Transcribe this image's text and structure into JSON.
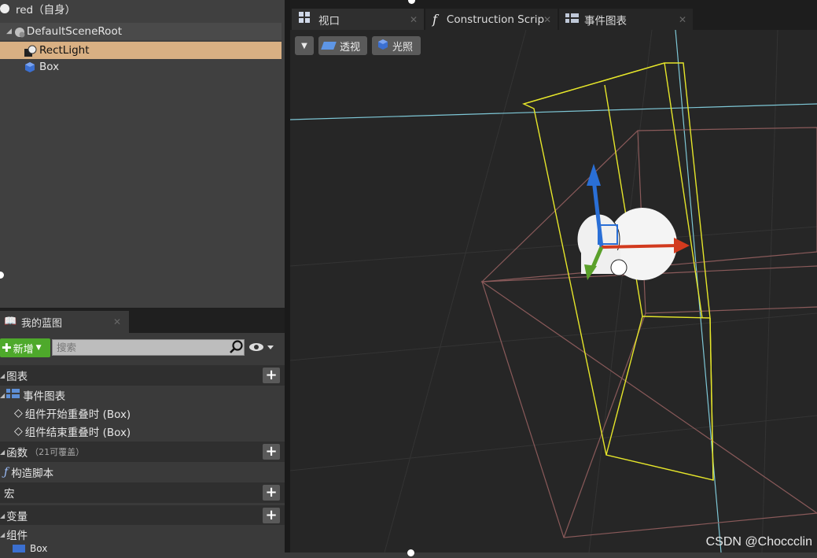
{
  "components": {
    "self": "red（自身）",
    "root": "DefaultSceneRoot",
    "items": [
      "RectLight",
      "Box"
    ]
  },
  "blueprint": {
    "tab_title": "我的蓝图",
    "add_label": "新增",
    "search_placeholder": "搜索",
    "sections": {
      "graphs": "图表",
      "event_graph": "事件图表",
      "events": [
        "组件开始重叠时 (Box)",
        "组件结束重叠时 (Box)"
      ],
      "functions": "函数",
      "functions_sub": "（21可覆盖）",
      "construction": "构造脚本",
      "macros": "宏",
      "variables": "变量",
      "components": "组件",
      "partial_item": "Box"
    }
  },
  "tabs": {
    "viewport": "视口",
    "construction": "Construction Scrip",
    "events": "事件图表"
  },
  "viewport": {
    "perspective_label": "透视",
    "lit_label": "光照"
  },
  "watermark": "CSDN @Choccclin",
  "colors": {
    "selection": "#d9b083",
    "add_button": "#4ea92b",
    "light_bounds": "#e6e62a",
    "box_bounds": "#8a5a5a",
    "axis_x": "#d23a1e",
    "axis_y": "#5aa02a",
    "axis_z": "#2a6fd6"
  }
}
